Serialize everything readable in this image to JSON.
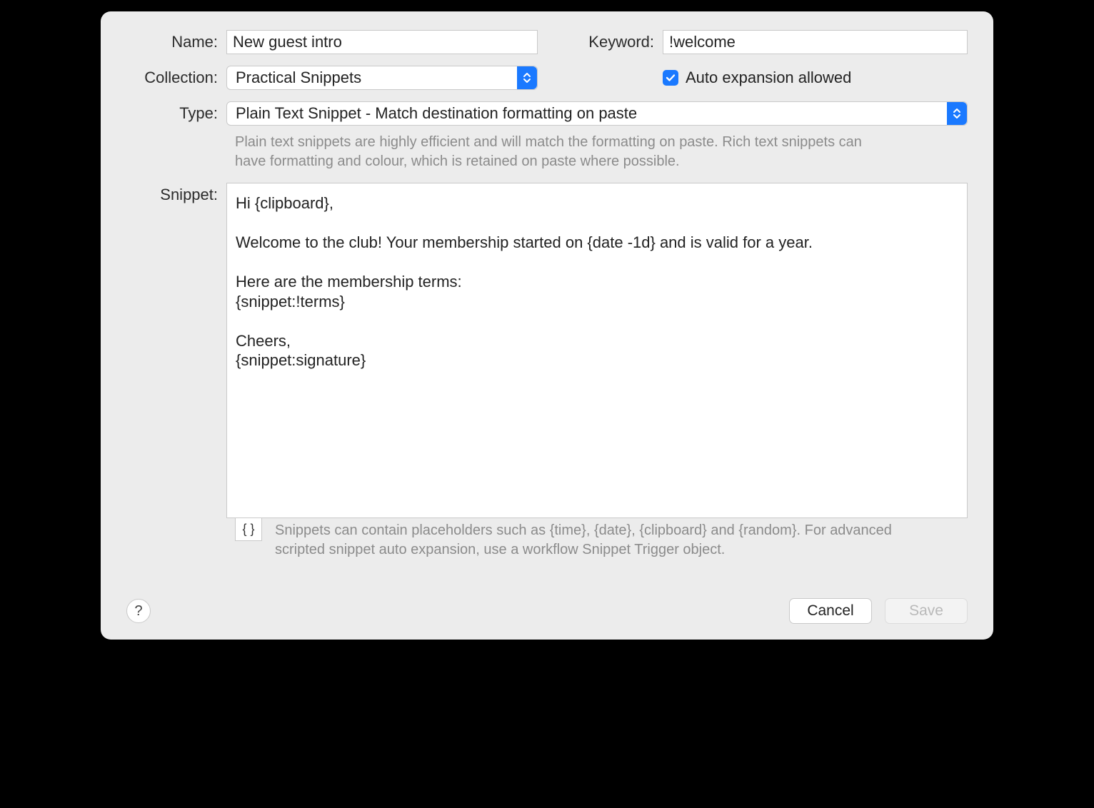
{
  "labels": {
    "name": "Name:",
    "keyword": "Keyword:",
    "collection": "Collection:",
    "type": "Type:",
    "snippet": "Snippet:"
  },
  "fields": {
    "name_value": "New guest intro",
    "keyword_value": "!welcome",
    "collection_value": "Practical Snippets",
    "auto_expansion_label": "Auto expansion allowed",
    "auto_expansion_checked": true,
    "type_value": "Plain Text Snippet - Match destination formatting on paste",
    "type_hint": "Plain text snippets are highly efficient and will match the formatting on paste. Rich text snippets can have formatting and colour, which is retained on paste where possible.",
    "snippet_value": "Hi {clipboard},\n\nWelcome to the club! Your membership started on {date -1d} and is valid for a year.\n\nHere are the membership terms:\n{snippet:!terms}\n\nCheers,\n{snippet:signature}"
  },
  "footer": {
    "braces_label": "{ }",
    "hint": "Snippets can contain placeholders such as {time}, {date}, {clipboard} and {random}. For advanced scripted snippet auto expansion, use a workflow Snippet Trigger object."
  },
  "buttons": {
    "help": "?",
    "cancel": "Cancel",
    "save": "Save"
  }
}
